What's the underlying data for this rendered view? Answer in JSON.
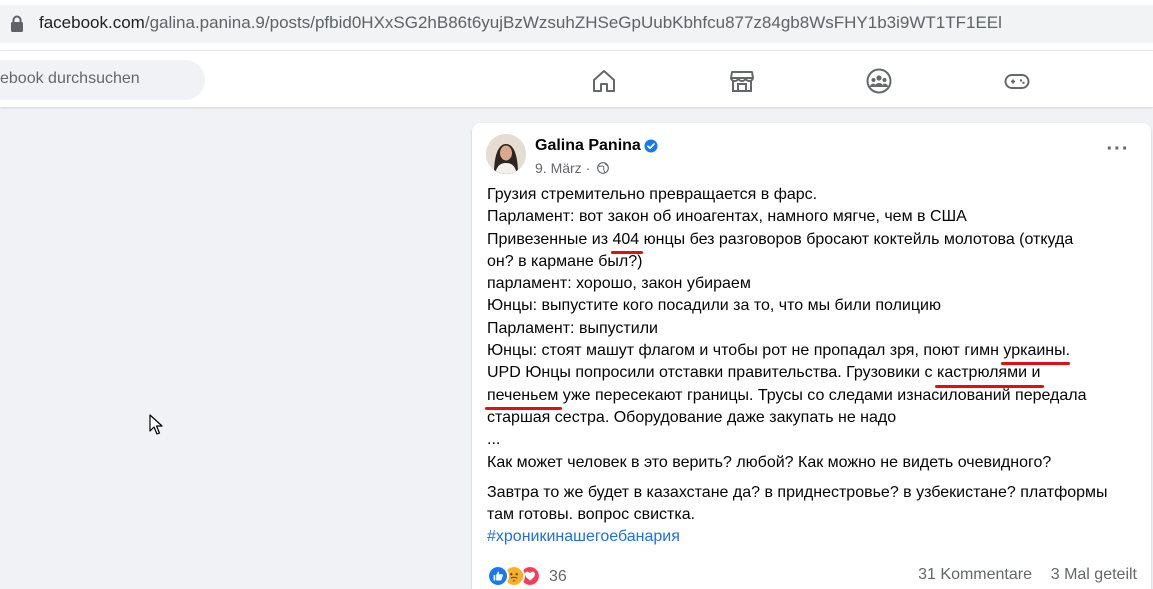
{
  "browser": {
    "url_host": "facebook.com",
    "url_path": "/galina.panina.9/posts/pfbid0HXxSG2hB86t6yujBzWzsuhZHSeGpUubKbhfcu877z84gb8WsFHY1b3i9WT1TF1EEl"
  },
  "header": {
    "search_placeholder": "ebook durchsuchen",
    "nav": [
      "home-icon",
      "marketplace-icon",
      "groups-icon",
      "gaming-icon"
    ]
  },
  "post": {
    "author": "Galina Panina",
    "date": "9. März",
    "separator": "·",
    "lines": [
      "Грузия стремительно превращается в фарс.",
      "Парламент: вот закон об иноагентах, намного мягче, чем в США",
      {
        "pre": "Привезенные из ",
        "u": "404",
        "post": " юнцы без разговоров бросают коктейль молотова (откуда"
      },
      "он? в кармане был?)",
      "парламент: хорошо, закон убираем",
      "Юнцы: выпустите кого посадили за то, что мы били полицию",
      "Парламент: выпустили",
      {
        "pre": "Юнцы: стоят машут флагом и чтобы рот не пропадал зря, поют гимн ",
        "u": "уркаины",
        "post": "."
      },
      {
        "pre": "UPD Юнцы попросили отставки правительства. Грузовики с ",
        "u": "кастрюлями и",
        "post": ""
      },
      {
        "pre": "",
        "u": "печеньем",
        "post": " уже пересекают границы. Трусы со следами изнасилований передала"
      },
      "старшая сестра. Оборудование даже закупать не надо",
      "...",
      "Как может человек в это верить? любой? Как можно не видеть очевидного?"
    ],
    "lines2": [
      "Завтра то же будет в казахстане да? в приднестровье? в узбекистане? платформы",
      "там готовы. вопрос свистка."
    ],
    "hashtag": "#хроникинашегоебанария",
    "reactions": {
      "count": "36",
      "types": [
        "like",
        "care",
        "love"
      ]
    },
    "comments": "31 Kommentare",
    "shares": "3 Mal geteilt"
  },
  "colors": {
    "accent": "#1877f2",
    "hashtag": "#216fdb",
    "underline_marker": "#e01010"
  }
}
